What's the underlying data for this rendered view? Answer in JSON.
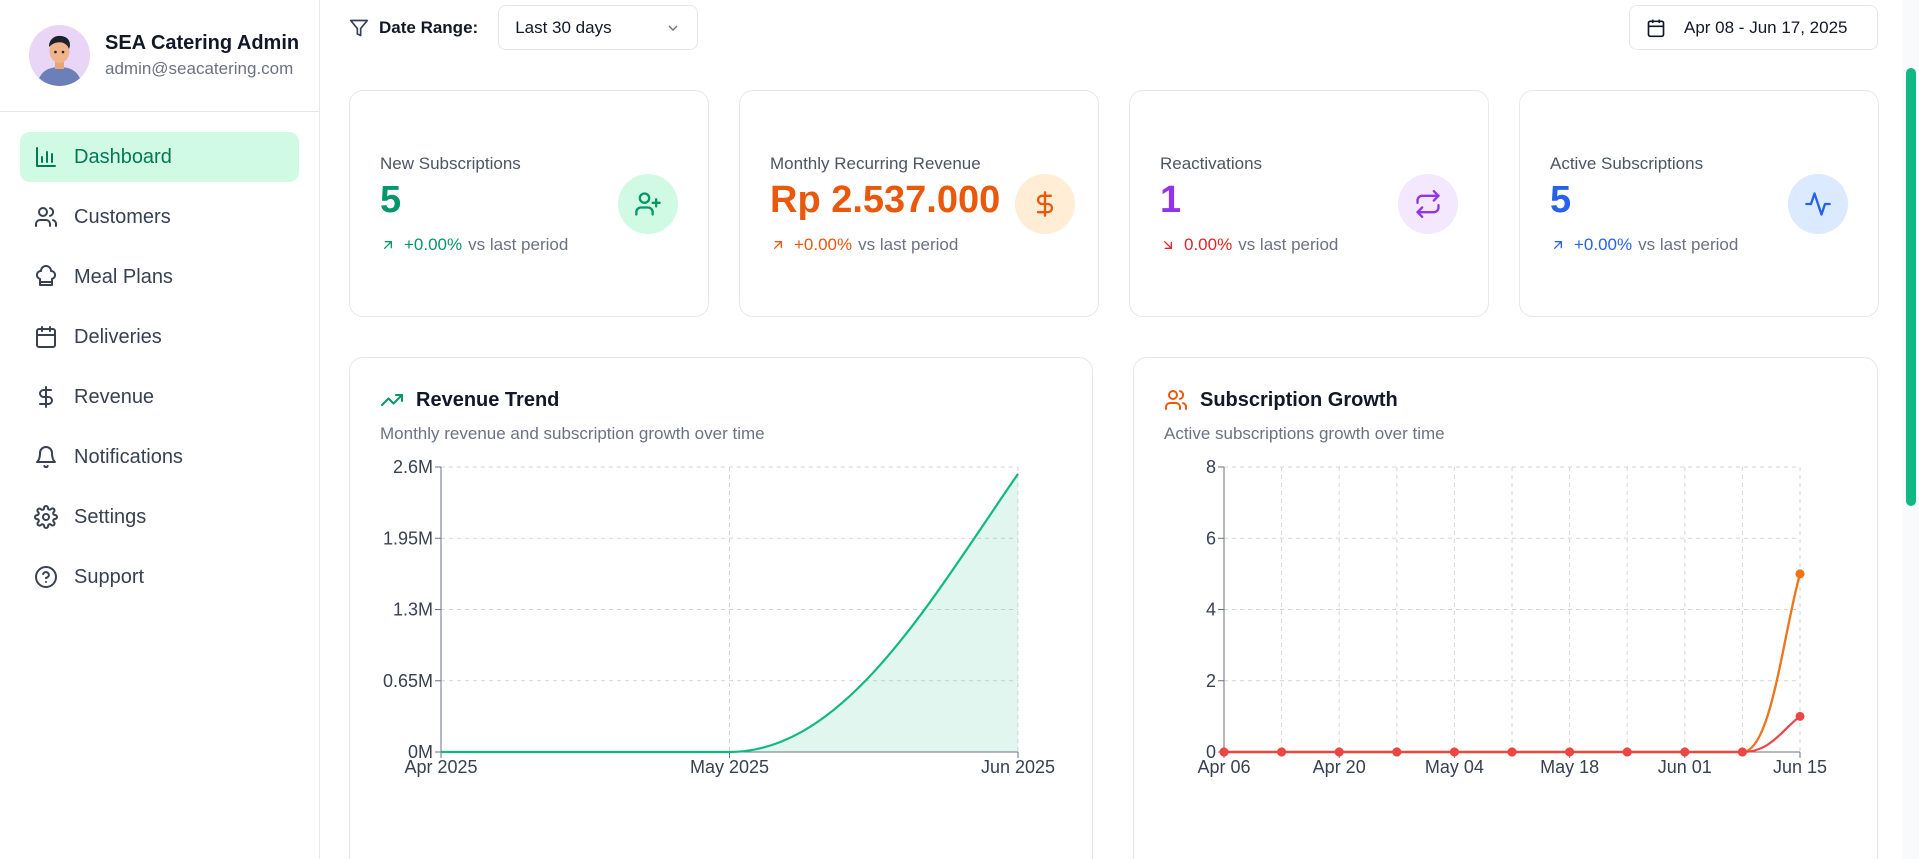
{
  "profile": {
    "name": "SEA Catering Admin",
    "email": "admin@seacatering.com"
  },
  "nav": [
    {
      "label": "Dashboard",
      "icon": "bar-chart-icon",
      "active": true
    },
    {
      "label": "Customers",
      "icon": "users-icon"
    },
    {
      "label": "Meal Plans",
      "icon": "chef-hat-icon"
    },
    {
      "label": "Deliveries",
      "icon": "calendar-icon"
    },
    {
      "label": "Revenue",
      "icon": "dollar-icon"
    },
    {
      "label": "Notifications",
      "icon": "bell-icon"
    },
    {
      "label": "Settings",
      "icon": "gear-icon"
    },
    {
      "label": "Support",
      "icon": "help-circle-icon"
    }
  ],
  "toolbar": {
    "date_range_label": "Date Range:",
    "selected_range": "Last 30 days",
    "date_display": "Apr 08 - Jun 17, 2025"
  },
  "cards": [
    {
      "label": "New Subscriptions",
      "value": "5",
      "delta": "+0.00%",
      "compare": "vs last period",
      "color": "#059669",
      "icon_bg": "#d1fae5",
      "icon": "user-plus-icon",
      "trend": "up"
    },
    {
      "label": "Monthly Recurring Revenue",
      "value": "Rp 2.537.000",
      "delta": "+0.00%",
      "compare": "vs last period",
      "color": "#ea580c",
      "icon_bg": "#ffedd5",
      "icon": "dollar-icon",
      "trend": "up"
    },
    {
      "label": "Reactivations",
      "value": "1",
      "delta": "0.00%",
      "compare": "vs last period",
      "color": "#9333ea",
      "icon_bg": "#f3e8ff",
      "icon": "repeat-icon",
      "delta_color": "#dc2626",
      "trend": "down"
    },
    {
      "label": "Active Subscriptions",
      "value": "5",
      "delta": "+0.00%",
      "compare": "vs last period",
      "color": "#2563eb",
      "icon_bg": "#dbeafe",
      "icon": "activity-icon",
      "trend": "up"
    }
  ],
  "revenue_panel": {
    "title": "Revenue Trend",
    "subtitle": "Monthly revenue and subscription growth over time"
  },
  "growth_panel": {
    "title": "Subscription Growth",
    "subtitle": "Active subscriptions growth over time"
  },
  "chart_data": [
    {
      "type": "area",
      "x": [
        "Apr 2025",
        "May 2025",
        "Jun 2025"
      ],
      "series": [
        {
          "values": [
            0,
            0,
            2537000
          ],
          "color": "#10b981"
        }
      ],
      "yticks": [
        "0M",
        "0.65M",
        "1.3M",
        "1.95M",
        "2.6M"
      ],
      "ylim": [
        0,
        2600000
      ],
      "grid": true
    },
    {
      "type": "line",
      "x": [
        "Apr 06",
        "Apr 13",
        "Apr 20",
        "Apr 27",
        "May 04",
        "May 11",
        "May 18",
        "May 25",
        "Jun 01",
        "Jun 08",
        "Jun 15"
      ],
      "xtick_labels": [
        "Apr 06",
        "Apr 20",
        "May 04",
        "May 18",
        "Jun 01",
        "Jun 15"
      ],
      "series": [
        {
          "values": [
            0,
            0,
            0,
            0,
            0,
            0,
            0,
            0,
            0,
            0,
            1
          ],
          "color": "#ef4444"
        },
        {
          "values": [
            0,
            0,
            0,
            0,
            0,
            0,
            0,
            0,
            0,
            0,
            5
          ],
          "color": "#10b981"
        },
        {
          "values": [
            0,
            0,
            0,
            0,
            0,
            0,
            0,
            0,
            0,
            0,
            5
          ],
          "color": "#f97316"
        }
      ],
      "yticks": [
        "0",
        "2",
        "4",
        "6",
        "8"
      ],
      "ylim": [
        0,
        8
      ],
      "grid": true
    }
  ]
}
